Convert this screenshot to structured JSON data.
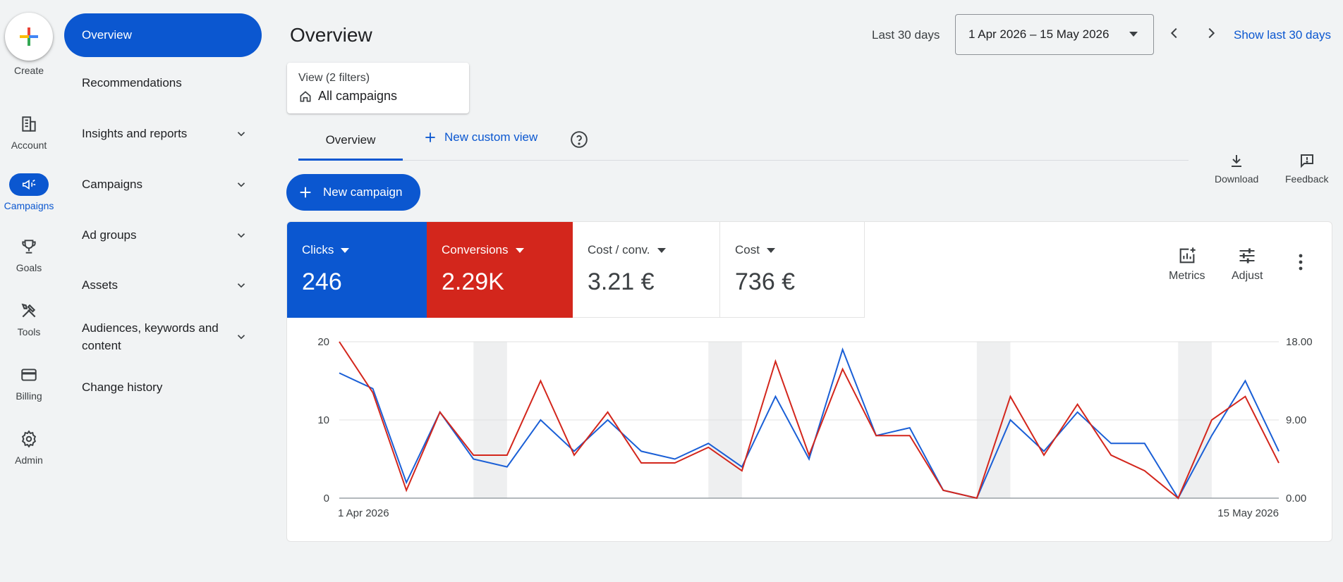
{
  "rail": {
    "create": "Create",
    "items": [
      {
        "label": "Account"
      },
      {
        "label": "Campaigns"
      },
      {
        "label": "Goals"
      },
      {
        "label": "Tools"
      },
      {
        "label": "Billing"
      },
      {
        "label": "Admin"
      }
    ]
  },
  "nav": {
    "items": [
      {
        "label": "Overview"
      },
      {
        "label": "Recommendations"
      },
      {
        "label": "Insights and reports"
      },
      {
        "label": "Campaigns"
      },
      {
        "label": "Ad groups"
      },
      {
        "label": "Assets"
      },
      {
        "label": "Audiences, keywords and content"
      },
      {
        "label": "Change history"
      }
    ]
  },
  "header": {
    "title": "Overview",
    "range_label": "Last 30 days",
    "date_range": "1 Apr 2026 – 15 May 2026",
    "show_last": "Show last 30 days"
  },
  "view": {
    "filters": "View (2 filters)",
    "name": "All campaigns"
  },
  "tabs": {
    "overview": "Overview",
    "new_custom_view": "New custom view"
  },
  "toolbar": {
    "download": "Download",
    "feedback": "Feedback",
    "new_campaign": "New campaign"
  },
  "metrics": [
    {
      "label": "Clicks",
      "value": "246"
    },
    {
      "label": "Conversions",
      "value": "2.29K"
    },
    {
      "label": "Cost / conv.",
      "value": "3.21 €"
    },
    {
      "label": "Cost",
      "value": "736 €"
    }
  ],
  "card_tools": {
    "metrics": "Metrics",
    "adjust": "Adjust"
  },
  "colors": {
    "accent": "#0b57d0",
    "conversions": "#d3261c"
  },
  "chart_data": {
    "type": "line",
    "x_start": "1 Apr 2026",
    "x_end": "15 May 2026",
    "y_left": {
      "ticks": [
        "0",
        "10",
        "20"
      ],
      "range": [
        0,
        20
      ]
    },
    "y_right": {
      "ticks": [
        "0.00",
        "9.00",
        "18.00"
      ],
      "range": [
        0,
        18
      ]
    },
    "series": [
      {
        "color": "#1a5fd6",
        "values": [
          16,
          14,
          2,
          11,
          5,
          4,
          10,
          6,
          10,
          6,
          5,
          7,
          4,
          13,
          5,
          19,
          8,
          9,
          1,
          0,
          10,
          6,
          11,
          7,
          7,
          0,
          8,
          15,
          6
        ]
      },
      {
        "color": "#d3261c",
        "values": [
          20,
          13.5,
          1,
          11,
          5.5,
          5.5,
          15,
          5.5,
          11,
          4.5,
          4.5,
          6.5,
          3.5,
          17.5,
          5.5,
          16.5,
          8,
          8,
          1,
          0,
          13,
          5.5,
          12,
          5.5,
          3.5,
          0,
          10,
          13,
          4.5
        ]
      }
    ],
    "weekend_bands": [
      [
        4,
        5
      ],
      [
        11,
        12
      ],
      [
        19,
        20
      ],
      [
        25,
        26
      ]
    ]
  }
}
